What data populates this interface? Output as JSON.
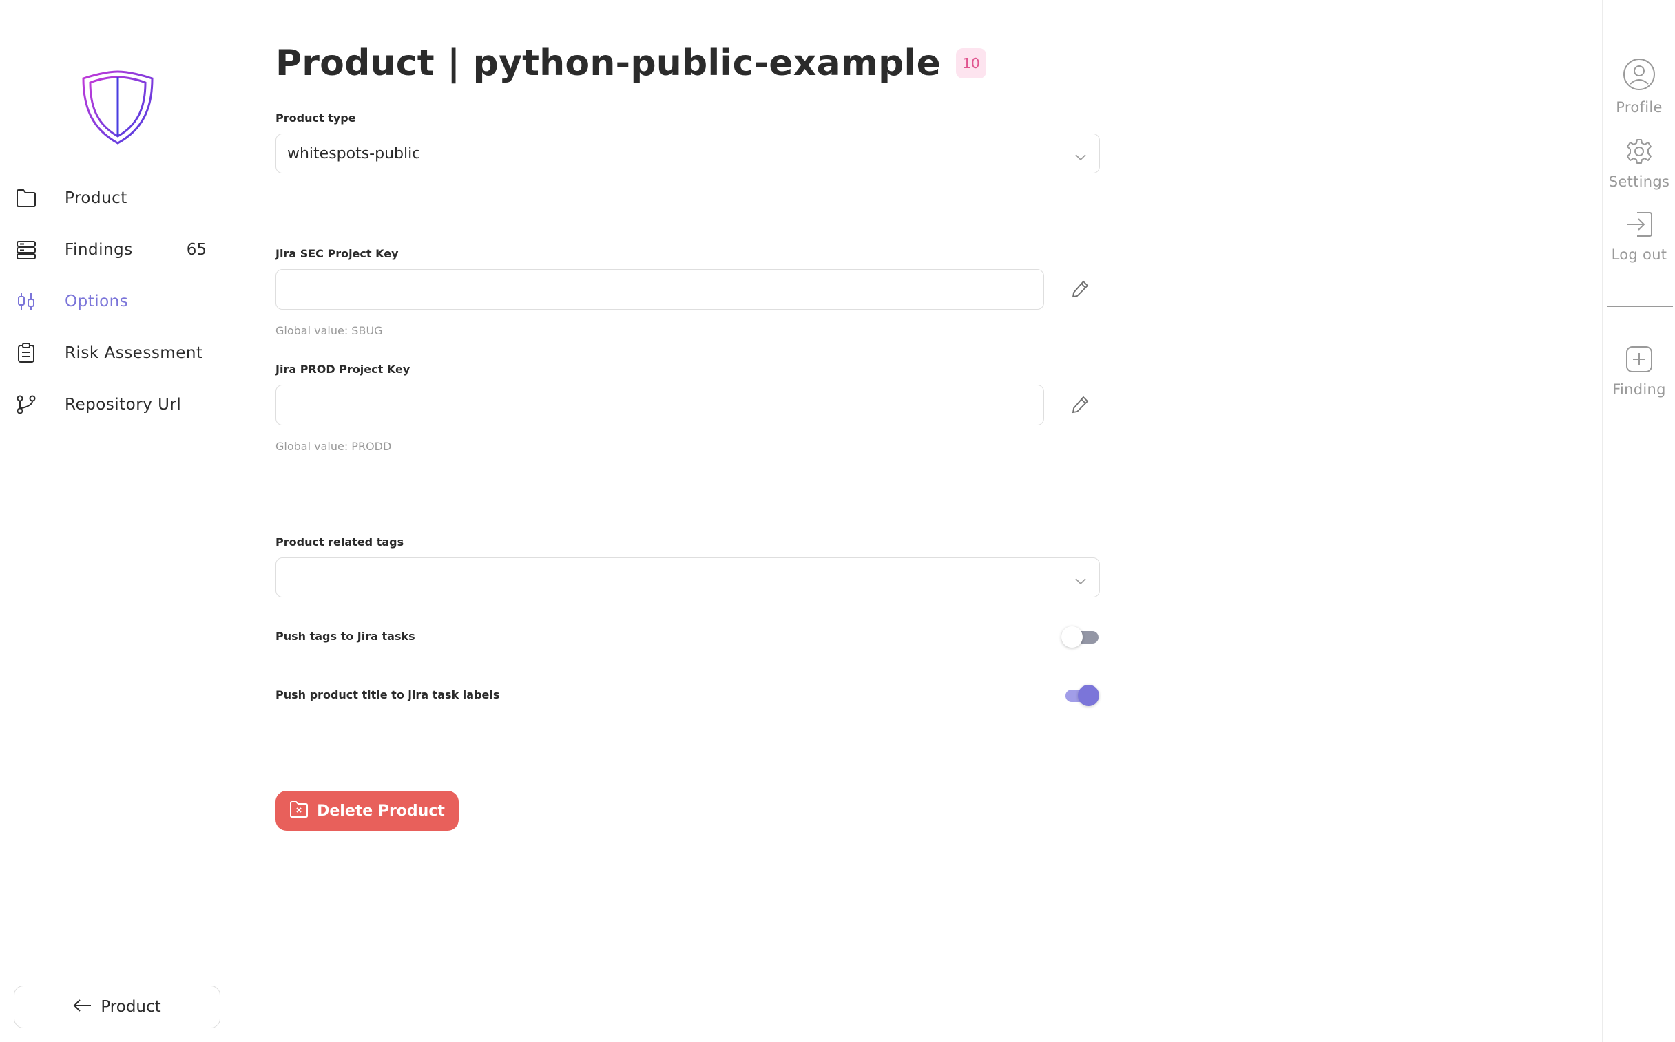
{
  "sidebar": {
    "items": [
      {
        "label": "Product",
        "icon": "folder-icon"
      },
      {
        "label": "Findings",
        "count": "65",
        "icon": "findings-icon"
      },
      {
        "label": "Options",
        "icon": "options-icon",
        "active": true
      },
      {
        "label": "Risk Assessment",
        "icon": "clipboard-icon"
      },
      {
        "label": "Repository Url",
        "icon": "git-branch-icon"
      }
    ],
    "back_label": "Product"
  },
  "header": {
    "title": "Product | python-public-example",
    "badge": "10"
  },
  "form": {
    "product_type": {
      "label": "Product type",
      "value": "whitespots-public"
    },
    "jira_sec": {
      "label": "Jira SEC Project Key",
      "value": "",
      "hint": "Global value: SBUG"
    },
    "jira_prod": {
      "label": "Jira PROD Project Key",
      "value": "",
      "hint": "Global value: PRODD"
    },
    "tags": {
      "label": "Product related tags",
      "value": ""
    },
    "push_tags": {
      "label": "Push tags to Jira tasks",
      "enabled": false
    },
    "push_title": {
      "label": "Push product title to jira task labels",
      "enabled": true
    },
    "delete_label": "Delete Product"
  },
  "right_sidebar": {
    "profile": "Profile",
    "settings": "Settings",
    "logout": "Log out",
    "finding": "Finding"
  },
  "colors": {
    "accent": "#7b75d9",
    "danger": "#e8605b",
    "badge_bg": "#fde4ef",
    "badge_text": "#e0558f"
  }
}
